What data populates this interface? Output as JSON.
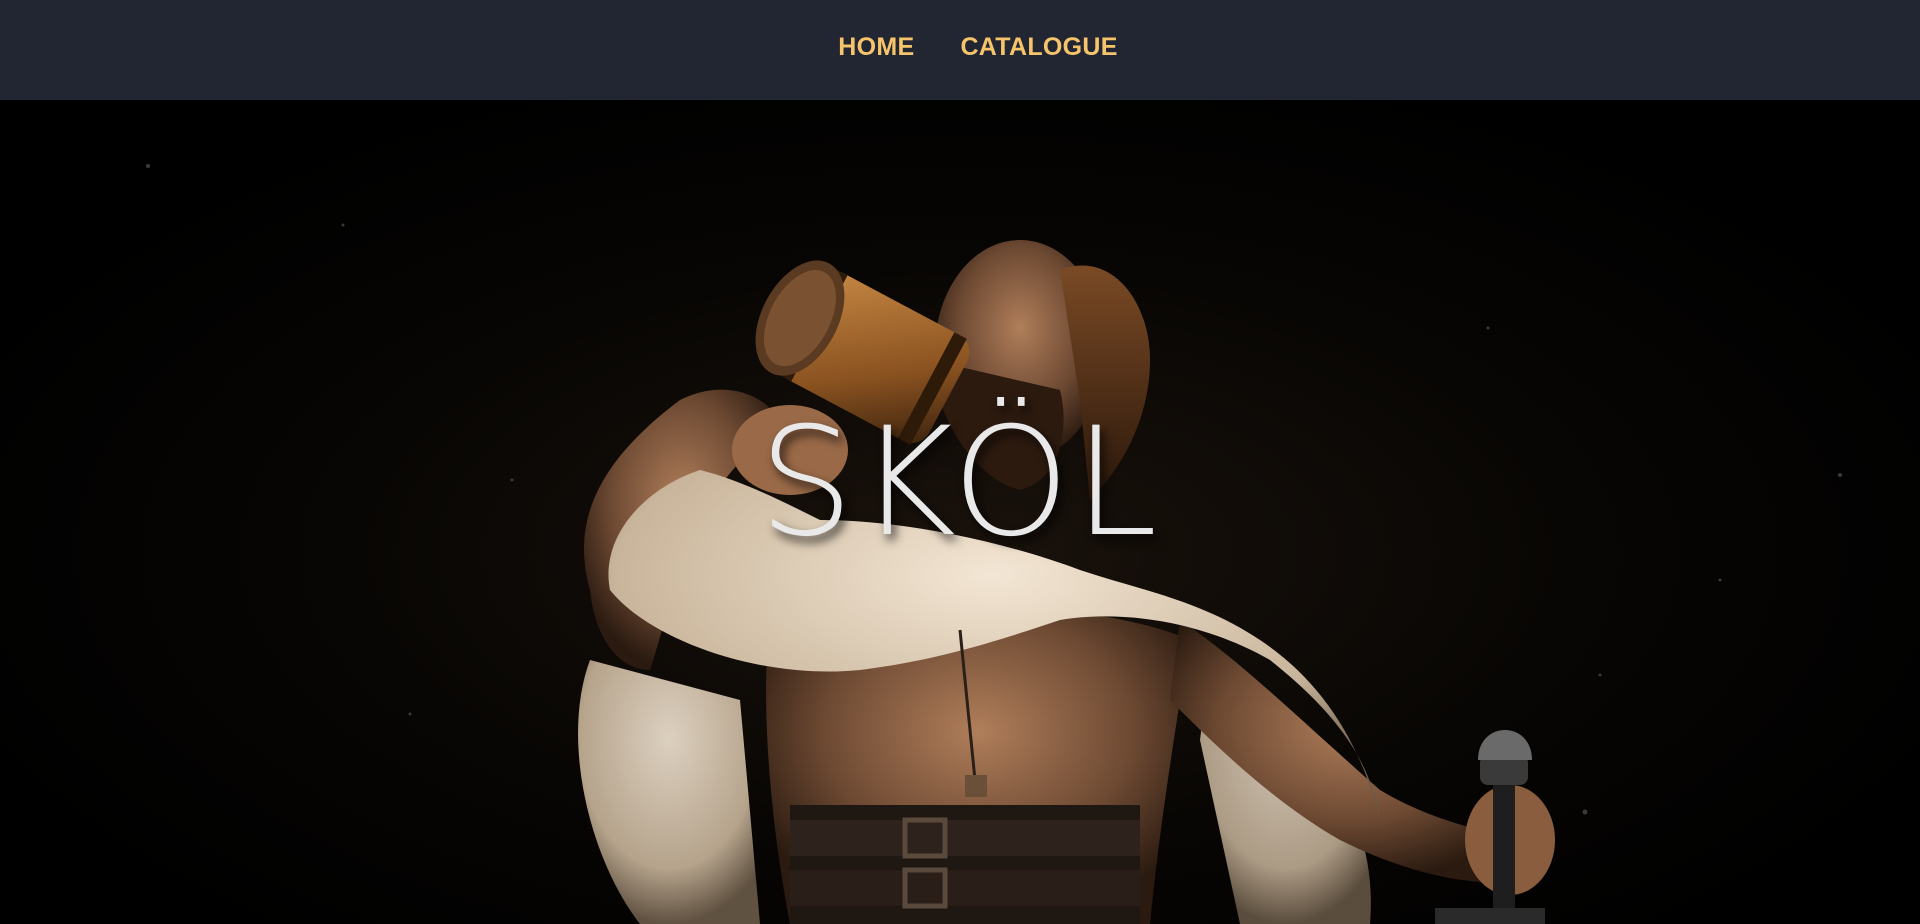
{
  "nav": {
    "items": [
      {
        "label": "HOME"
      },
      {
        "label": "CATALOGUE"
      }
    ]
  },
  "hero": {
    "title": "SKÖL"
  },
  "colors": {
    "navbar_bg": "#212632",
    "nav_link": "#f6c46b",
    "hero_title": "#e9e9e9"
  }
}
